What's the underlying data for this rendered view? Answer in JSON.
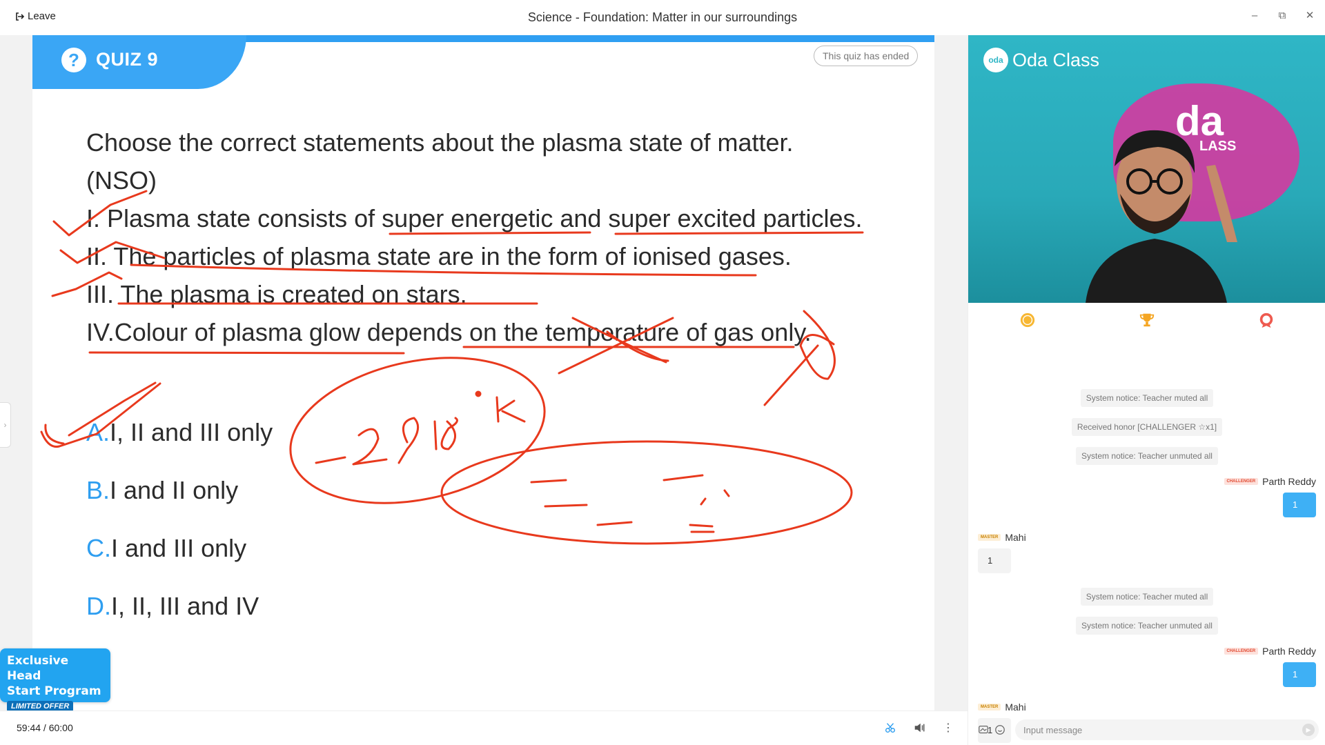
{
  "topbar": {
    "leave_label": "Leave",
    "title": "Science - Foundation: Matter in our surroundings"
  },
  "quiz": {
    "tab_icon": "?",
    "tab_title": "QUIZ 9",
    "status": "This quiz has ended",
    "question_lines": [
      "Choose the correct statements about the plasma state of matter.",
      "(NSO)",
      "I. Plasma state consists of super energetic and super excited particles.",
      "II. The particles of plasma state are in the form of ionised gases.",
      "III. The plasma is created on stars.",
      "IV.Colour of plasma glow depends on the temperature of gas only."
    ],
    "options": [
      {
        "letter": "A.",
        "text": " I, II and III only"
      },
      {
        "letter": "B.",
        "text": " I and II only"
      },
      {
        "letter": "C.",
        "text": " I and III only"
      },
      {
        "letter": "D.",
        "text": " I, II, III and IV"
      }
    ],
    "annotation_color": "#e8391d"
  },
  "promo": {
    "line1": "Exclusive Head",
    "line2": "Start Program",
    "line3": "LIMITED OFFER"
  },
  "bottombar": {
    "timer": "59:44 / 60:00"
  },
  "video": {
    "brand": "Oda Class",
    "logo_mark": "oda",
    "backdrop_text": "da",
    "backdrop_sub": "LASS"
  },
  "chat": {
    "notices": [
      "System notice: Teacher muted all",
      "Received honor [CHALLENGER ☆x1]",
      "System notice: Teacher unmuted all",
      "System notice: Teacher muted all",
      "System notice: Teacher unmuted all"
    ],
    "messages": [
      {
        "user": "Parth Reddy",
        "badge": "CHALLENGER",
        "text": "1"
      },
      {
        "user": "Mahi",
        "badge": "MASTER",
        "text": "1"
      },
      {
        "user": "Parth Reddy",
        "badge": "CHALLENGER",
        "text": "1"
      },
      {
        "user": "Mahi",
        "badge": "MASTER",
        "text": "1"
      }
    ],
    "input_placeholder": "Input message"
  },
  "colors": {
    "accent": "#3aa6f5",
    "option_letter": "#2e9ef0",
    "bubble_blue": "#3eb0f5"
  }
}
